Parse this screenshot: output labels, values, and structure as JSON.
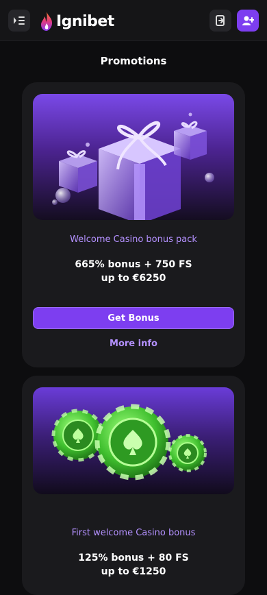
{
  "header": {
    "brand": "Ignibet"
  },
  "page": {
    "title": "Promotions"
  },
  "promotions": [
    {
      "name": "Welcome Casino bonus pack",
      "offer_line1": "665% bonus + 750 FS",
      "offer_line2": "up to €6250",
      "cta": "Get Bonus",
      "more": "More info"
    },
    {
      "name": "First welcome Casino bonus",
      "offer_line1": "125% bonus + 80 FS",
      "offer_line2": "up to €1250"
    }
  ],
  "colors": {
    "accent": "#7d3ef0",
    "accent_text": "#b491ff",
    "chip_green": "#5ee84a"
  }
}
